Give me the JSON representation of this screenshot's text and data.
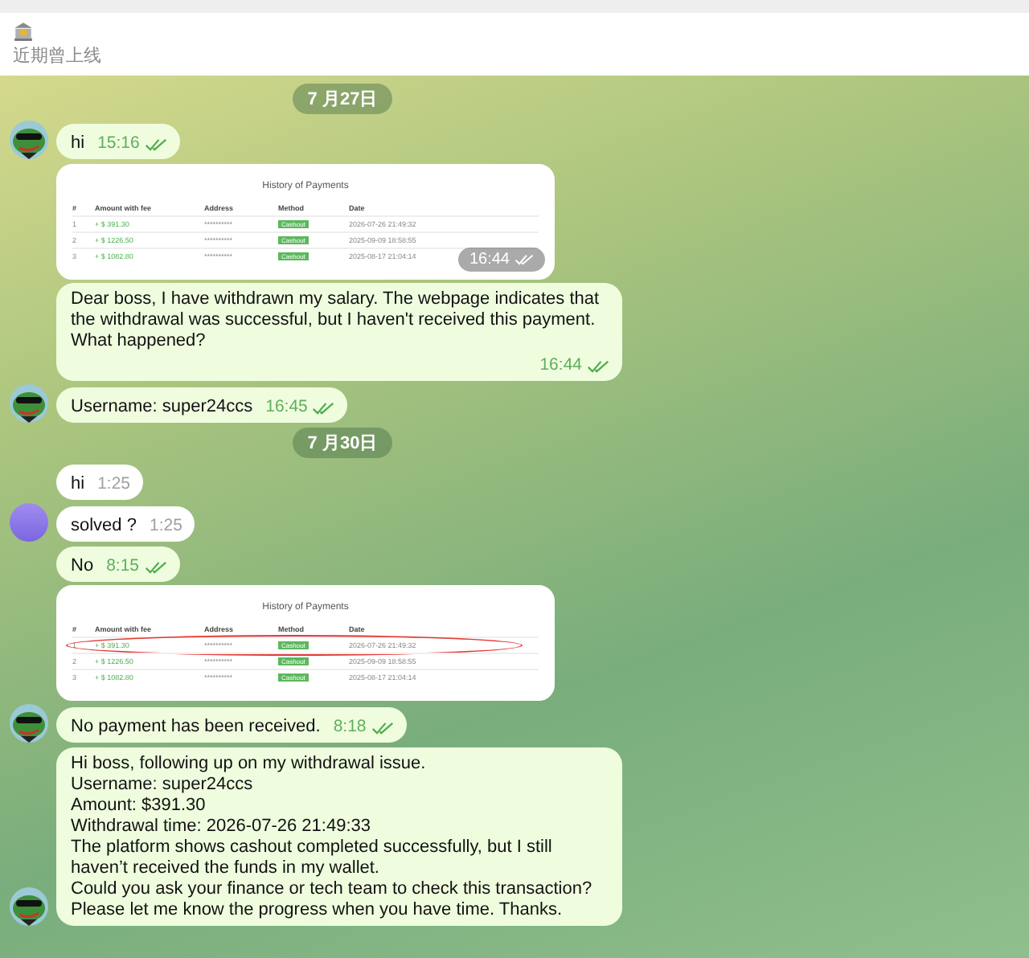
{
  "header": {
    "status": "近期曾上线"
  },
  "messages": [
    {
      "kind": "date",
      "text": "7 月27日"
    },
    {
      "kind": "text",
      "outgoing": true,
      "text": "hi",
      "time": "15:16",
      "avatar": {
        "kind": "frog"
      }
    },
    {
      "kind": "image",
      "outgoing": true,
      "time": "16:44",
      "table": {
        "title": "History of Payments",
        "columns": [
          "#",
          "Amount with fee",
          "Address",
          "Method",
          "Date"
        ],
        "rows": [
          {
            "cells": [
              "1",
              "+ $ 391.30",
              "**********",
              "Cashout",
              "2026-07-26 21:49:32"
            ],
            "circled": false
          },
          {
            "cells": [
              "2",
              "+ $ 1226.50",
              "**********",
              "Cashout",
              "2025-09-09 18:58:55"
            ],
            "circled": false
          },
          {
            "cells": [
              "3",
              "+ $ 1082.80",
              "**********",
              "Cashout",
              "2025-08-17 21:04:14"
            ],
            "circled": false
          }
        ]
      }
    },
    {
      "kind": "text",
      "outgoing": true,
      "text": "Dear boss, I have withdrawn my salary. The webpage indicates that the withdrawal was successful, but I haven't received this payment. What happened?",
      "time": "16:44"
    },
    {
      "kind": "text",
      "outgoing": true,
      "text": "Username: super24ccs",
      "time": "16:45",
      "avatar": {
        "kind": "frog"
      }
    },
    {
      "kind": "date",
      "text": "7 月30日"
    },
    {
      "kind": "text",
      "outgoing": false,
      "text": "hi",
      "time": "1:25"
    },
    {
      "kind": "text",
      "outgoing": false,
      "text": "solved ?",
      "time": "1:25",
      "avatar": {
        "kind": "circle"
      }
    },
    {
      "kind": "text",
      "outgoing": true,
      "text": "No",
      "time": "8:15"
    },
    {
      "kind": "image",
      "outgoing": true,
      "table": {
        "title": "History of Payments",
        "columns": [
          "#",
          "Amount with fee",
          "Address",
          "Method",
          "Date"
        ],
        "rows": [
          {
            "cells": [
              "1",
              "+ $ 391.30",
              "**********",
              "Cashout",
              "2026-07-26 21:49:32"
            ],
            "circled": true
          },
          {
            "cells": [
              "2",
              "+ $ 1226.50",
              "**********",
              "Cashout",
              "2025-09-09 18:58:55"
            ],
            "circled": false
          },
          {
            "cells": [
              "3",
              "+ $ 1082.80",
              "**********",
              "Cashout",
              "2025-08-17 21:04:14"
            ],
            "circled": false
          }
        ]
      }
    },
    {
      "kind": "text",
      "outgoing": true,
      "text": "No payment has been received.",
      "time": "8:18",
      "avatar": {
        "kind": "frog"
      }
    },
    {
      "kind": "text",
      "outgoing": true,
      "text": "Hi boss, following up on my withdrawal issue.\nUsername: super24ccs\nAmount: $391.30\nWithdrawal time: 2026-07-26 21:49:33\nThe platform shows cashout completed successfully, but I still haven’t received the funds in my wallet.\nCould you ask your finance or tech team to check this transaction?\nPlease let me know the progress when you have time. Thanks.",
      "avatar": {
        "kind": "frog"
      }
    }
  ]
}
